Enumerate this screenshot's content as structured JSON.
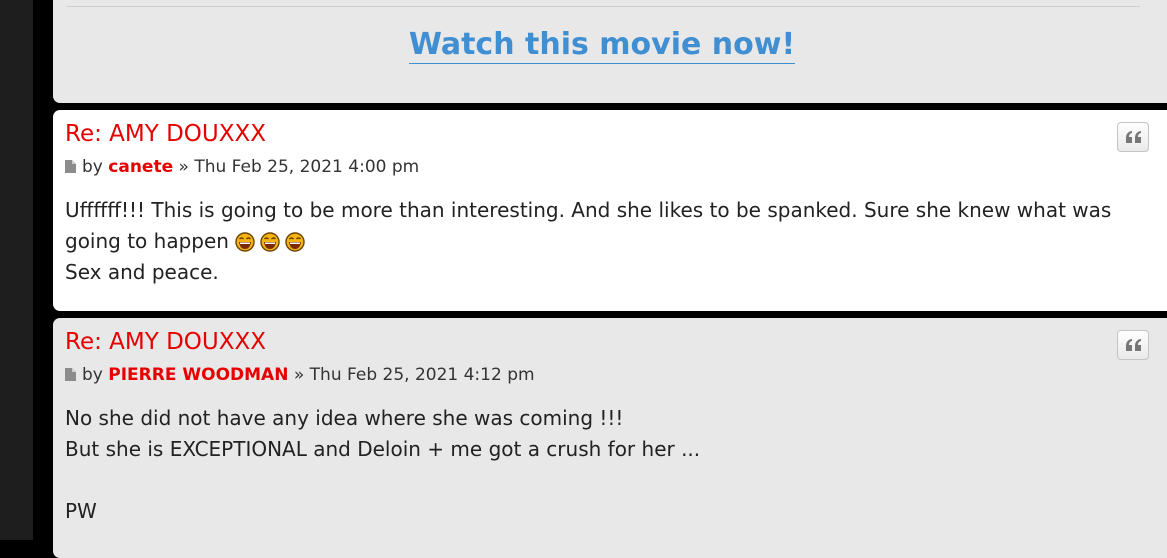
{
  "promo": {
    "link_text": "Watch this movie now!"
  },
  "posts": [
    {
      "title": "Re: AMY DOUXXX",
      "by": "by",
      "author": "canete",
      "separator": "»",
      "date": "Thu Feb 25, 2021 4:00 pm",
      "line1": "Uffffff!!! This is going to be more than interesting. And she likes to be spanked. Sure she knew what was",
      "line2": "going to happen",
      "line3": "Sex and peace.",
      "emoji": "laughing-face-emoji"
    },
    {
      "title": "Re: AMY DOUXXX",
      "by": "by",
      "author": "PIERRE WOODMAN",
      "separator": "»",
      "date": "Thu Feb 25, 2021 4:12 pm",
      "line1": "No she did not have any idea where she was coming !!!",
      "line2": "But she is EXCEPTIONAL and Deloin + me got a crush for her ...",
      "line3": "",
      "line4": "PW"
    }
  ],
  "colors": {
    "title": "#e60000",
    "author": "#e60000",
    "link": "#3f8fd2",
    "post_bg_alt": "#e8e8e8",
    "post_bg": "#ffffff"
  },
  "icons": {
    "quote": "quote-icon",
    "post": "post-file-icon"
  }
}
